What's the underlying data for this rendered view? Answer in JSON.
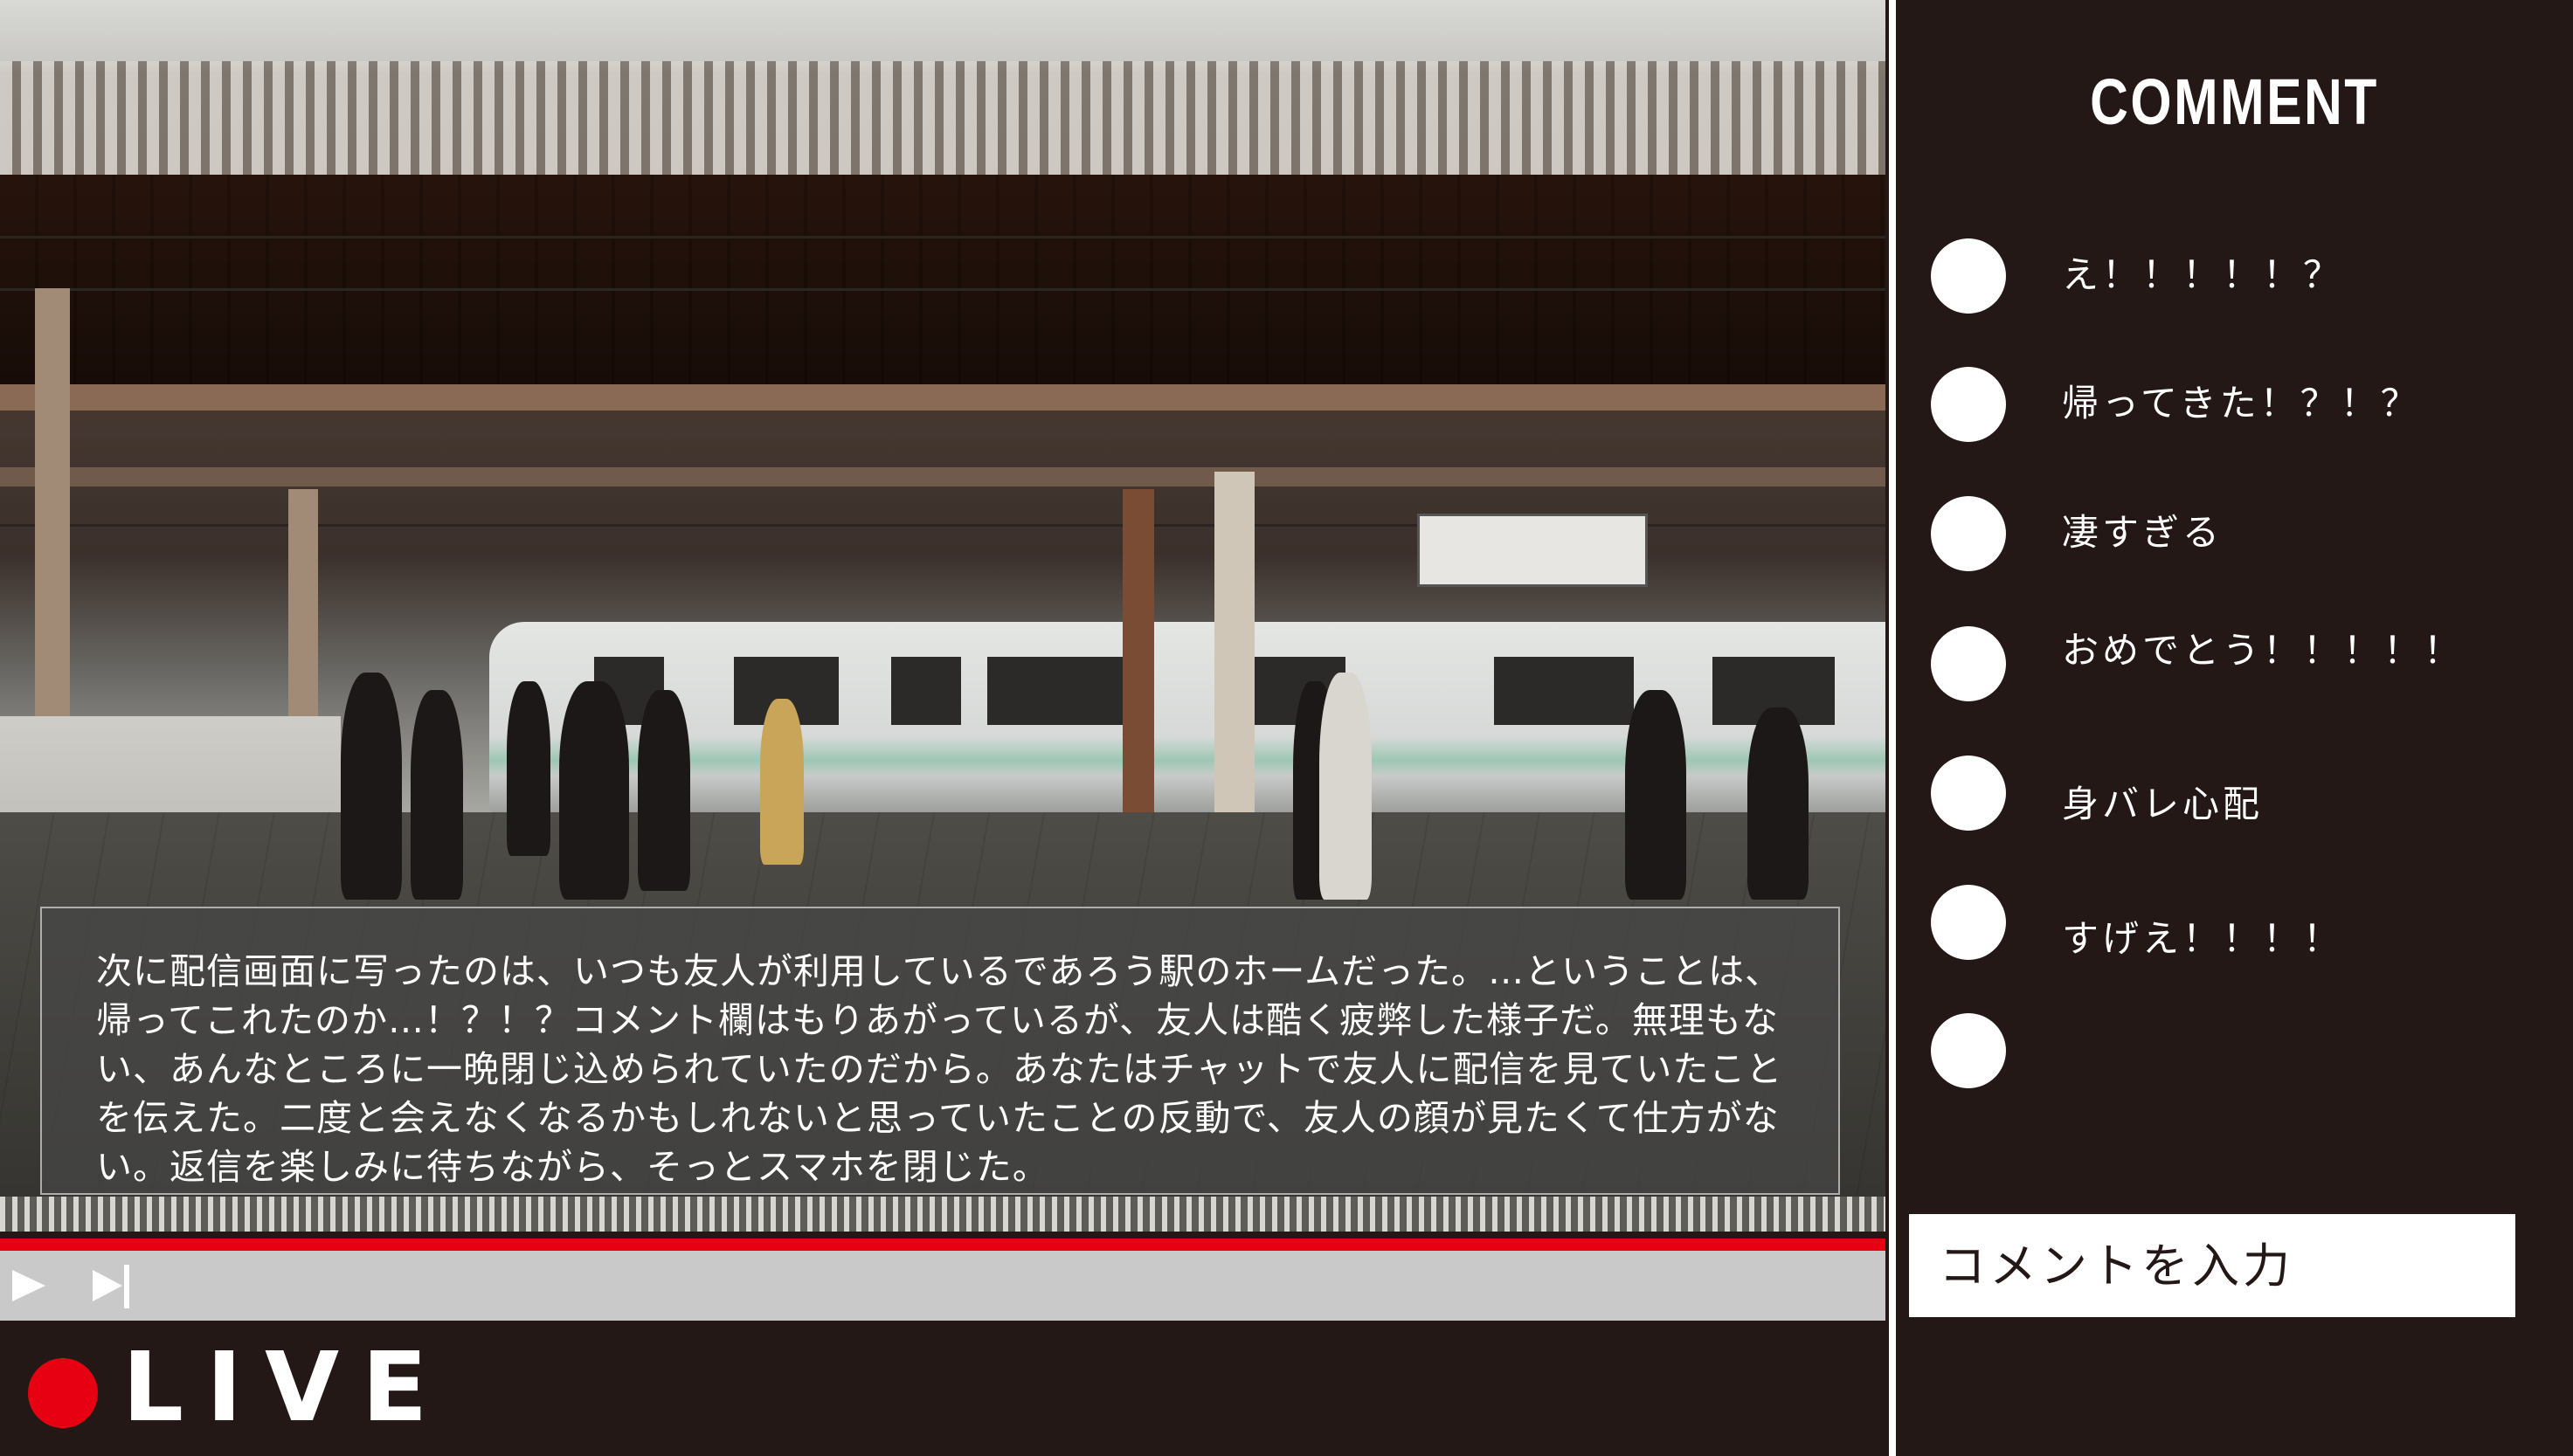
{
  "video": {
    "narration": "次に配信画面に写ったのは、いつも友人が利用しているであろう駅のホームだった。…ということは、帰ってこれたのか…！？！？コメント欄はもりあがっているが、友人は酷く疲弊した様子だ。無理もない、あんなところに一晩閉じ込められていたのだから。あなたはチャットで友人に配信を見ていたことを伝えた。二度と会えなくなるかもしれないと思っていたことの反動で、友人の顔が見たくて仕方がない。返信を楽しみに待ちながら、そっとスマホを閉じた。",
    "progress": 1.0,
    "progress_color": "#e60012"
  },
  "controls": {
    "play_icon": "play-icon",
    "next_icon": "skip-next-icon"
  },
  "live": {
    "label": "LIVE",
    "dot_color": "#e60012"
  },
  "comments": {
    "title": "COMMENT",
    "items": [
      {
        "text": "え！！！！！？"
      },
      {
        "text": "帰ってきた！？！？"
      },
      {
        "text": "凄すぎる"
      },
      {
        "text": "おめでとう！！！！！"
      },
      {
        "text": "身バレ心配"
      },
      {
        "text": "すげえ！！！！"
      },
      {
        "text": ""
      }
    ],
    "input_placeholder": "コメントを入力"
  }
}
